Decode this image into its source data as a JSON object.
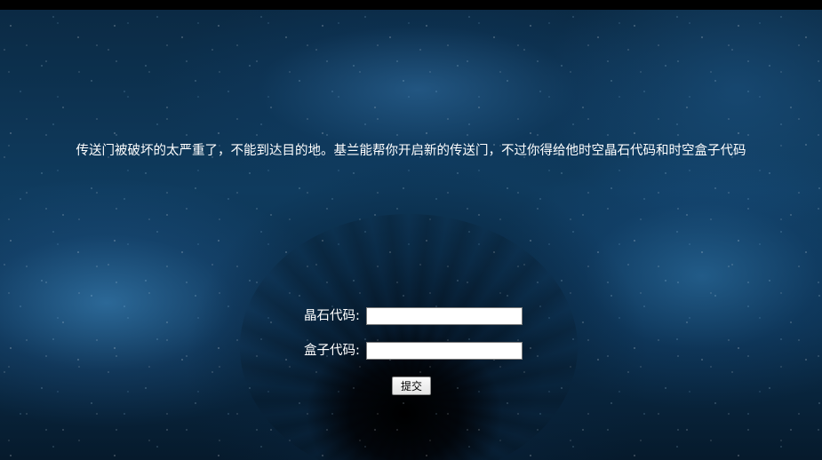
{
  "message": "传送门被破坏的太严重了，不能到达目的地。基兰能帮你开启新的传送门，不过你得给他时空晶石代码和时空盒子代码",
  "form": {
    "crystal_label": "晶石代码:",
    "crystal_value": "",
    "box_label": "盒子代码:",
    "box_value": "",
    "submit_label": "提交"
  },
  "colors": {
    "background": "#0f3b5e",
    "text": "#ffffff"
  }
}
